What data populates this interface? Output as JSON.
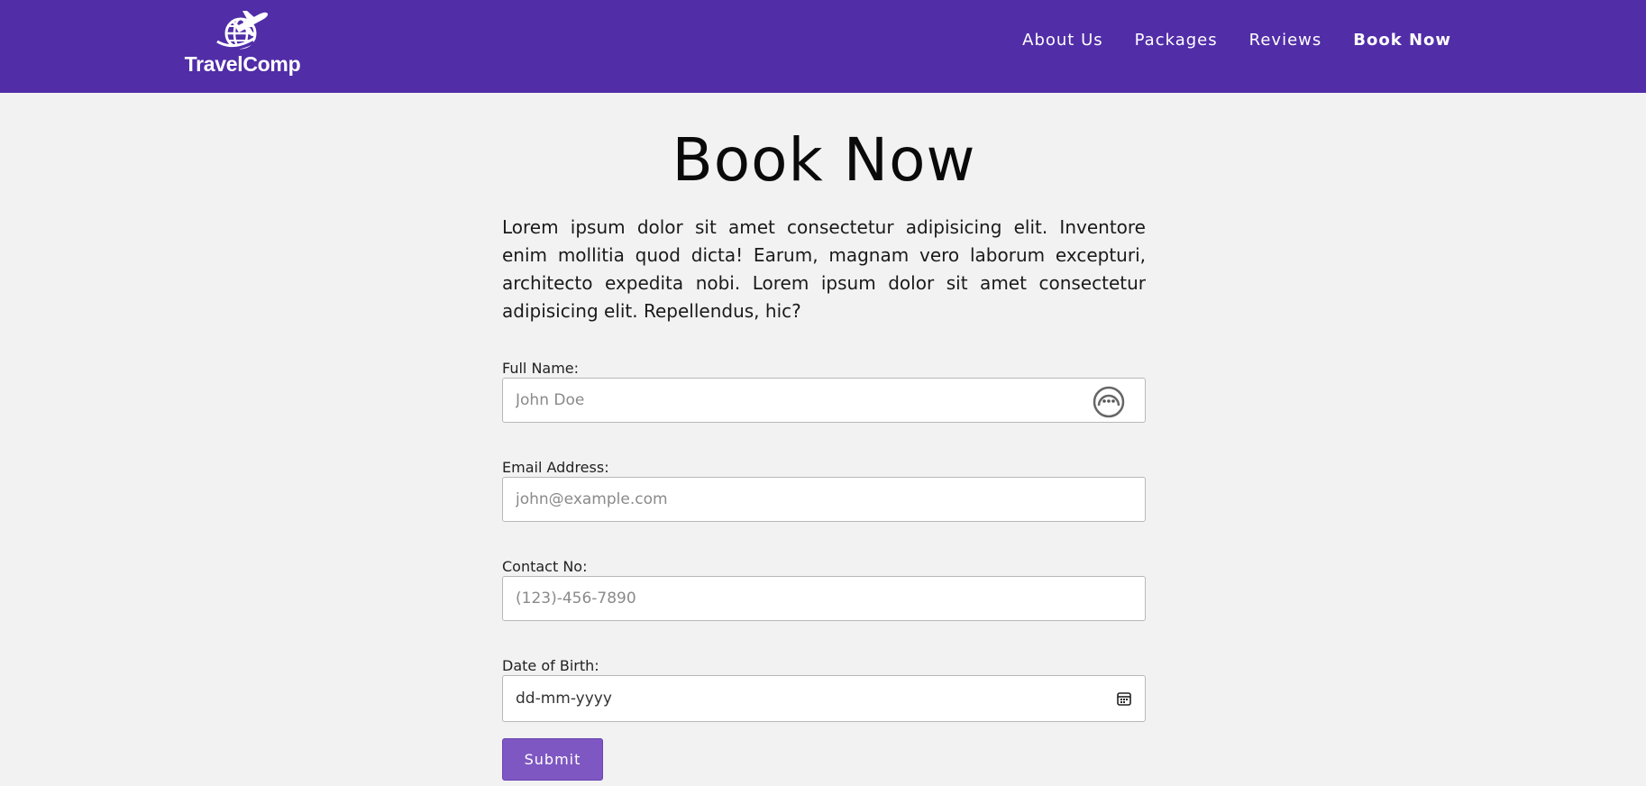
{
  "brand": {
    "name": "TravelComp",
    "logo_icon": "plane-globe-icon"
  },
  "nav": {
    "items": [
      {
        "label": "About Us",
        "active": false
      },
      {
        "label": "Packages",
        "active": false
      },
      {
        "label": "Reviews",
        "active": false
      },
      {
        "label": "Book Now",
        "active": true
      }
    ]
  },
  "page": {
    "title": "Book Now",
    "intro": "Lorem ipsum dolor sit amet consectetur adipisicing elit. Inventore enim mollitia quod dicta! Earum, magnam vero laborum excepturi, architecto expedita nobi. Lorem ipsum dolor sit amet consectetur adipisicing elit. Repellendus, hic?"
  },
  "form": {
    "full_name": {
      "label": "Full Name:",
      "placeholder": "John Doe",
      "value": ""
    },
    "email": {
      "label": "Email Address:",
      "placeholder": "john@example.com",
      "value": ""
    },
    "contact": {
      "label": "Contact No:",
      "placeholder": "(123)-456-7890",
      "value": ""
    },
    "dob": {
      "label": "Date of Birth:",
      "display": "dd-mm-yyyy"
    },
    "submit_label": "Submit"
  },
  "colors": {
    "navbar": "#512da8",
    "button": "#7e57c2",
    "background": "#f2f2f2"
  }
}
